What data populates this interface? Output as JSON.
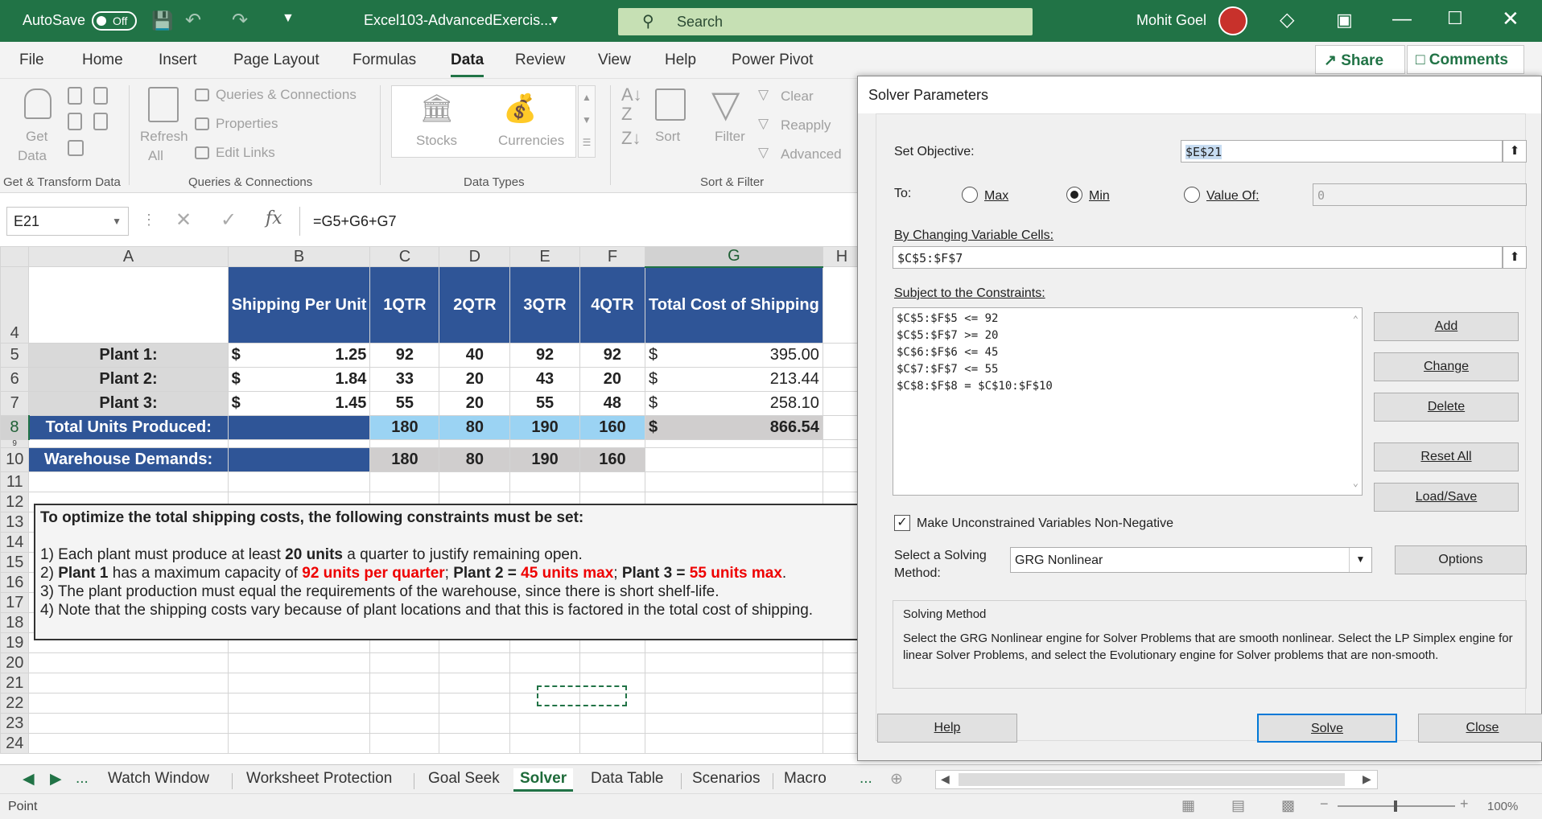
{
  "titlebar": {
    "autosave_label": "AutoSave",
    "autosave_state": "Off",
    "filename": "Excel103-AdvancedExercis...",
    "search_placeholder": "Search",
    "user": "Mohit Goel"
  },
  "menu": [
    "File",
    "Home",
    "Insert",
    "Page Layout",
    "Formulas",
    "Data",
    "Review",
    "View",
    "Help",
    "Power Pivot"
  ],
  "menu_active": "Data",
  "share_label": "Share",
  "comments_label": "Comments",
  "ribbon": {
    "get_data": "Get",
    "get_data2": "Data",
    "queries_connections": "Queries & Connections",
    "properties": "Properties",
    "edit_links": "Edit Links",
    "refresh": "Refresh",
    "refresh2": "All",
    "stocks": "Stocks",
    "currencies": "Currencies",
    "sort": "Sort",
    "filter": "Filter",
    "clear": "Clear",
    "reapply": "Reapply",
    "advanced": "Advanced",
    "groups": [
      "Get & Transform Data",
      "Queries & Connections",
      "Data Types",
      "Sort & Filter"
    ]
  },
  "formula_bar": {
    "name_box": "E21",
    "fx": "fx",
    "formula": "=G5+G6+G7"
  },
  "sheet": {
    "columns": [
      "A",
      "B",
      "C",
      "D",
      "E",
      "F",
      "G",
      "H"
    ],
    "selected_col": "G",
    "header": {
      "b": "Shipping Per Unit",
      "c": "1QTR",
      "d": "2QTR",
      "e": "3QTR",
      "f": "4QTR",
      "g": "Total Cost of Shipping"
    },
    "plants": [
      {
        "row": "5",
        "name": "Plant 1:",
        "cur": "$",
        "rate": "1.25",
        "q1": "92",
        "q2": "40",
        "q3": "92",
        "q4": "92",
        "total": "395.00"
      },
      {
        "row": "6",
        "name": "Plant 2:",
        "cur": "$",
        "rate": "1.84",
        "q1": "33",
        "q2": "20",
        "q3": "43",
        "q4": "20",
        "total": "213.44"
      },
      {
        "row": "7",
        "name": "Plant 3:",
        "cur": "$",
        "rate": "1.45",
        "q1": "55",
        "q2": "20",
        "q3": "55",
        "q4": "48",
        "total": "258.10"
      }
    ],
    "totals": {
      "label": "Total Units Produced:",
      "q1": "180",
      "q2": "80",
      "q3": "190",
      "q4": "160",
      "cur": "$",
      "total": "866.54"
    },
    "demands": {
      "label": "Warehouse Demands:",
      "q1": "180",
      "q2": "80",
      "q3": "190",
      "q4": "160"
    },
    "notes": {
      "heading": "To optimize the total shipping costs, the following constraints must be set:",
      "l1a": "1)  Each plant must produce at least ",
      "l1b": "20 units",
      "l1c": " a quarter to justify remaining open.",
      "l2a": "2)  ",
      "l2b": "Plant 1",
      "l2c": " has a maximum capacity of ",
      "l2d": "92 units per quarter",
      "l2e": "; ",
      "l2f": "Plant 2 = ",
      "l2g": "45 units max",
      "l2h": "; ",
      "l2i": "Plant 3 = ",
      "l2j": "55 units max",
      "l2k": ".",
      "l3": "3)  The plant production must equal the requirements of the warehouse, since there is short shelf-life.",
      "l4": "4)  Note that the shipping costs vary because of plant locations and that this is factored in the total cost of shipping."
    }
  },
  "tabs": [
    "Watch Window",
    "Worksheet Protection",
    "Goal Seek",
    "Solver",
    "Data Table",
    "Scenarios",
    "Macro"
  ],
  "tab_active": "Solver",
  "status": "Point",
  "zoom": "100%",
  "solver": {
    "title": "Solver Parameters",
    "set_objective_label": "Set Objective:",
    "objective": "$E$21",
    "to_label": "To:",
    "opt_max": "Max",
    "opt_min": "Min",
    "opt_value": "Value Of:",
    "selected": "Min",
    "value_of": "0",
    "changing_label": "By Changing Variable Cells:",
    "changing": "$C$5:$F$7",
    "constraints_label": "Subject to the Constraints:",
    "constraints": [
      "$C$5:$F$5 <= 92",
      "$C$5:$F$7 >= 20",
      "$C$6:$F$6 <= 45",
      "$C$7:$F$7 <= 55",
      "$C$8:$F$8 = $C$10:$F$10"
    ],
    "buttons": {
      "add": "Add",
      "change": "Change",
      "delete": "Delete",
      "reset": "Reset All",
      "load": "Load/Save"
    },
    "nonneg_label": "Make Unconstrained Variables Non-Negative",
    "method_label1": "Select a Solving",
    "method_label2": "Method:",
    "method": "GRG Nonlinear",
    "options": "Options",
    "method_box_title": "Solving Method",
    "method_desc": "Select the GRG Nonlinear engine for Solver Problems that are smooth nonlinear. Select the LP Simplex engine for linear Solver Problems, and select the Evolutionary engine for Solver problems that are non-smooth.",
    "help": "Help",
    "solve": "Solve",
    "close": "Close"
  }
}
